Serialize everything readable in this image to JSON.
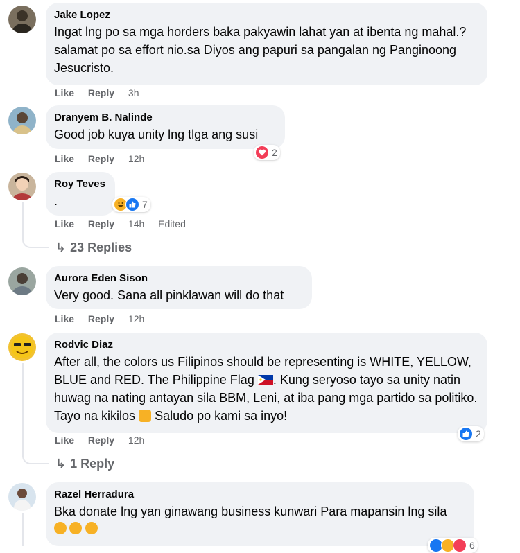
{
  "labels": {
    "like": "Like",
    "reply": "Reply",
    "edited": "Edited"
  },
  "comments": [
    {
      "author": "Jake Lopez",
      "text": "Ingat lng po sa mga horders baka pakyawin lahat yan at ibenta ng mahal.?salamat po sa effort nio.sa Diyos ang papuri sa pangalan ng Panginoong Jesucristo.",
      "time": "3h"
    },
    {
      "author": "Dranyem B. Nalinde",
      "text": "Good job kuya unity lng tlga ang susi",
      "time": "12h",
      "reactions": {
        "count": "2",
        "icons": [
          "heart-icon"
        ]
      }
    },
    {
      "author": "Roy Teves",
      "text": ".",
      "time": "14h",
      "edited": true,
      "reactions": {
        "count": "7",
        "icons": [
          "haha-icon",
          "like-icon"
        ]
      },
      "replies_label": "23 Replies"
    },
    {
      "author": "Aurora Eden Sison",
      "text": "Very good. Sana all pinklawan will do that",
      "time": "12h"
    },
    {
      "author": "Rodvic Diaz",
      "text_parts": [
        "After all, the colors us Filipinos should be representing is WHITE, YELLOW, BLUE and RED. The Philippine Flag ",
        ". Kung seryoso tayo sa unity natin huwag na nating antayan sila BBM, Leni, at iba pang mga partido sa politiko. Tayo na kikilos ",
        " Saludo po kami sa inyo!"
      ],
      "time": "12h",
      "reactions": {
        "count": "2",
        "icons": [
          "like-icon"
        ]
      },
      "replies_label": "1 Reply"
    },
    {
      "author": "Razel Herradura",
      "text": "Bka donate lng yan ginawang business kunwari Para mapansin lng sila",
      "time": "",
      "reactions": {
        "count": "6",
        "icons": [
          "like-icon",
          "haha-icon",
          "heart-icon"
        ]
      }
    }
  ],
  "colors": {
    "bubble": "#f0f2f5",
    "secondary_text": "#65676b",
    "like_blue": "#1877f2",
    "heart_red": "#f33e58",
    "haha_yellow": "#f7b125"
  }
}
